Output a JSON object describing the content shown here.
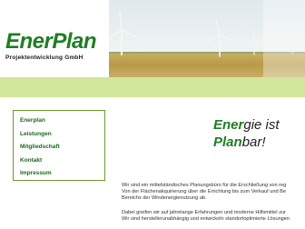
{
  "logo": {
    "name": "EnerPlan",
    "tagline": "Projektentwicklung GmbH"
  },
  "nav": {
    "items": [
      {
        "label": "Enerplan"
      },
      {
        "label": "Leistungen"
      },
      {
        "label": "Mitgliedschaft"
      },
      {
        "label": "Kontakt"
      },
      {
        "label": "Impressum"
      }
    ]
  },
  "slogan": {
    "line1_bold": "Ener",
    "line1_rest": "gie ist",
    "line2_bold": "Plan",
    "line2_rest": "bar!"
  },
  "body": {
    "paragraph1_line1": "Wir sind ein mittelständisches Planungsbüro für die Erschließung von reg",
    "paragraph1_line2": "Von der Flächenakquirierung über die Errichtung bis zum Verkauf und Be",
    "paragraph1_line3": "Bereichs der Windenergienutzung ab.",
    "paragraph2_line1": "Dabei greifen wir auf jahrelange Erfahrungen und moderne Hilfsmittel zur",
    "paragraph2_line2": "Wir sind herstellerunabhängig und entwickeln standortoptimierte Lösungen"
  },
  "colors": {
    "brand_green": "#1f7d24",
    "band_green": "#d2e69c",
    "nav_border": "#6a9a2c"
  }
}
